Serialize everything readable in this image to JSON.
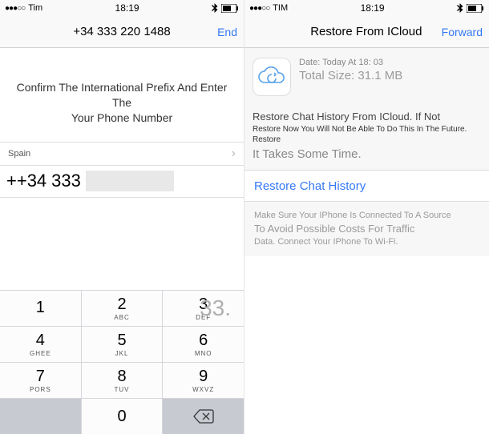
{
  "left": {
    "status": {
      "carrier": "Tim",
      "time": "18:19"
    },
    "nav": {
      "title": "+34 333 220 1488",
      "action": "End"
    },
    "instruction_line1": "Confirm The International Prefix And Enter The",
    "instruction_line2": "Your Phone Number",
    "country": {
      "name": "Spain"
    },
    "phone": {
      "prefix": "++34",
      "entered": "333"
    },
    "keypad": {
      "k1": "1",
      "k1sub": "",
      "k2": "2",
      "k2sub": "ABC",
      "k3": "3",
      "k3sub": "DEF",
      "k3ghost": "33.",
      "k4": "4",
      "k4sub": "Ghee",
      "k5": "5",
      "k5sub": "JKL",
      "k6": "6",
      "k6sub": "MNO",
      "k7": "7",
      "k7sub": "PoRS",
      "k8": "8",
      "k8sub": "TUV",
      "k9": "9",
      "k9sub": "Wxvz",
      "k0": "0"
    }
  },
  "right": {
    "status": {
      "carrier": "TIM",
      "time": "18:19"
    },
    "nav": {
      "title": "Restore From ICloud",
      "action": "Forward"
    },
    "cloud": {
      "date": "Date: Today At 18: 03",
      "size": "Total Size: 31.1 MB"
    },
    "desc": {
      "l1": "Restore Chat History From ICloud. If Not",
      "l2": "Restore Now You Will Not Be Able To Do This In The Future. Restore",
      "l3": "It Takes Some Time."
    },
    "restore_button": "Restore Chat History",
    "footer": {
      "f1": "Make Sure Your IPhone Is Connected To A Source",
      "f2": "To Avoid Possible Costs For Traffic",
      "f3": "Data. Connect Your IPhone To Wi-Fi."
    }
  }
}
